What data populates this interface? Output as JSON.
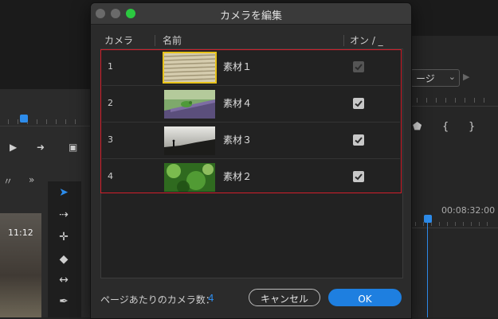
{
  "dialog": {
    "title": "カメラを編集",
    "columns": {
      "camera": "カメラ",
      "name": "名前",
      "onoff": "オン / _"
    },
    "rows": [
      {
        "number": "1",
        "name": "素材１",
        "checked": true,
        "enabled": false,
        "thumbnail": "blinds-image",
        "selected": true
      },
      {
        "number": "2",
        "name": "素材４",
        "checked": true,
        "enabled": true,
        "thumbnail": "frog-on-rail-image",
        "selected": false
      },
      {
        "number": "3",
        "name": "素材３",
        "checked": true,
        "enabled": true,
        "thumbnail": "silhouette-landscape-image",
        "selected": false
      },
      {
        "number": "4",
        "name": "素材２",
        "checked": true,
        "enabled": true,
        "thumbnail": "green-foliage-image",
        "selected": false
      }
    ],
    "footer": {
      "label": "ページあたりのカメラ数：",
      "value": "4",
      "cancel_label": "キャンセル",
      "ok_label": "OK"
    }
  },
  "background": {
    "thumbnail_time": "11:12",
    "right_select": "ージ",
    "timecode": "00:08:32:00"
  },
  "colors": {
    "accent": "#2d8ceb",
    "highlight_frame": "#d41e2b",
    "selected_thumb": "#e7c21a",
    "zoom_light": "#2bc840"
  }
}
